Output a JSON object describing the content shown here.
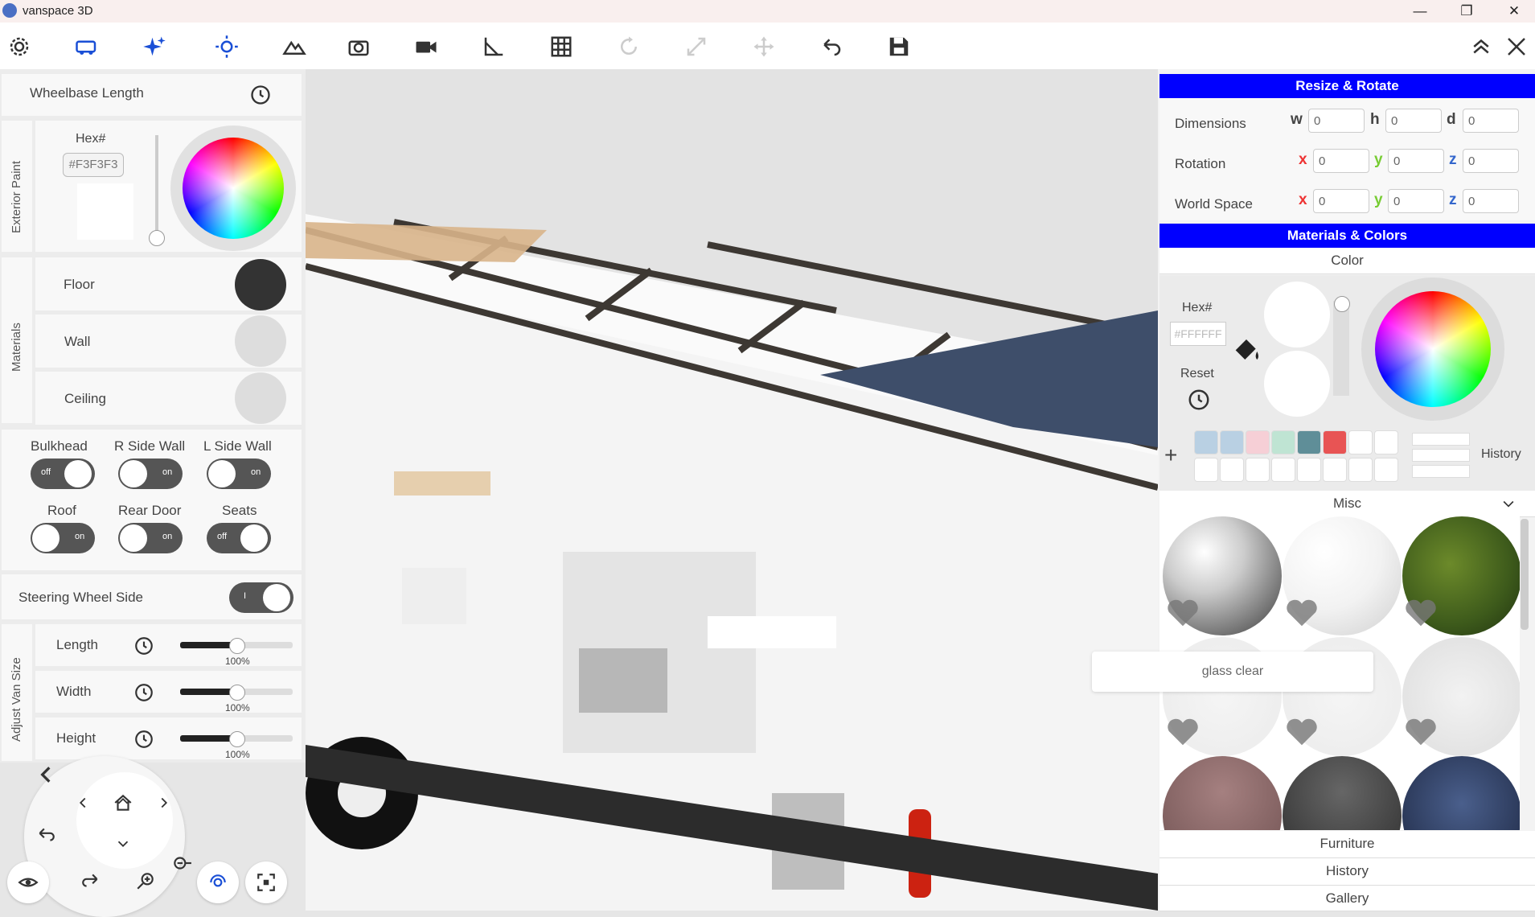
{
  "app": {
    "title": "vanspace 3D"
  },
  "window": {
    "minimize": "—",
    "maximize": "❐",
    "close": "✕"
  },
  "toolbar": {
    "icons": [
      "gear-icon",
      "van-icon",
      "sparkle-icon",
      "sun-icon",
      "mountain-icon",
      "camera-icon",
      "video-icon",
      "measure-icon",
      "grid-icon",
      "rotate-icon",
      "resize-icon",
      "move-icon",
      "undo-icon",
      "save-icon"
    ],
    "collapse": "⌃⌃",
    "close": "✕"
  },
  "left": {
    "wheelbase_label": "Wheelbase Length",
    "exterior_paint_label": "Exterior Paint",
    "hex_label": "Hex#",
    "hex_value": "#F3F3F3",
    "materials_label": "Materials",
    "materials": [
      {
        "label": "Floor",
        "color": "#333333"
      },
      {
        "label": "Wall",
        "color": "#dddddd"
      },
      {
        "label": "Ceiling",
        "color": "#dddddd"
      }
    ],
    "toggles": [
      {
        "label": "Bulkhead",
        "state": "off"
      },
      {
        "label": "R Side Wall",
        "state": "on"
      },
      {
        "label": "L Side Wall",
        "state": "on"
      },
      {
        "label": "Roof",
        "state": "on"
      },
      {
        "label": "Rear Door",
        "state": "on"
      },
      {
        "label": "Seats",
        "state": "off"
      }
    ],
    "steering_label": "Steering Wheel Side",
    "steering_state": "I",
    "van_size_label": "Adjust Van Size",
    "sizes": [
      {
        "label": "Length",
        "percent": "100%"
      },
      {
        "label": "Width",
        "percent": "100%"
      },
      {
        "label": "Height",
        "percent": "100%"
      }
    ]
  },
  "right": {
    "resize_header": "Resize & Rotate",
    "rows": [
      {
        "label": "Dimensions",
        "axes": [
          "w",
          "h",
          "d"
        ],
        "values": [
          "0",
          "0",
          "0"
        ]
      },
      {
        "label": "Rotation",
        "axes": [
          "x",
          "y",
          "z"
        ],
        "values": [
          "0",
          "0",
          "0"
        ]
      },
      {
        "label": "World Space",
        "axes": [
          "x",
          "y",
          "z"
        ],
        "values": [
          "0",
          "0",
          "0"
        ]
      }
    ],
    "materials_header": "Materials & Colors",
    "color_label": "Color",
    "hex_label": "Hex#",
    "hex_placeholder": "#FFFFFF",
    "reset_label": "Reset",
    "history_label": "History",
    "plus": "+",
    "chips": [
      "#b9d0e3",
      "#b9d0e3",
      "#f6cfd6",
      "#bfe4d3",
      "#5f8e98",
      "#e85454",
      "#ffffff",
      "#ffffff",
      "#ffffff",
      "#ffffff",
      "#ffffff",
      "#ffffff",
      "#ffffff",
      "#ffffff",
      "#ffffff",
      "#ffffff"
    ],
    "misc_label": "Misc",
    "tooltip": "glass clear",
    "sections": [
      "Furniture",
      "History",
      "Gallery"
    ]
  },
  "colors": {
    "accent_blue": "#0000ff",
    "axis_x": "#e33",
    "axis_y": "#7c3",
    "axis_z": "#36c"
  }
}
